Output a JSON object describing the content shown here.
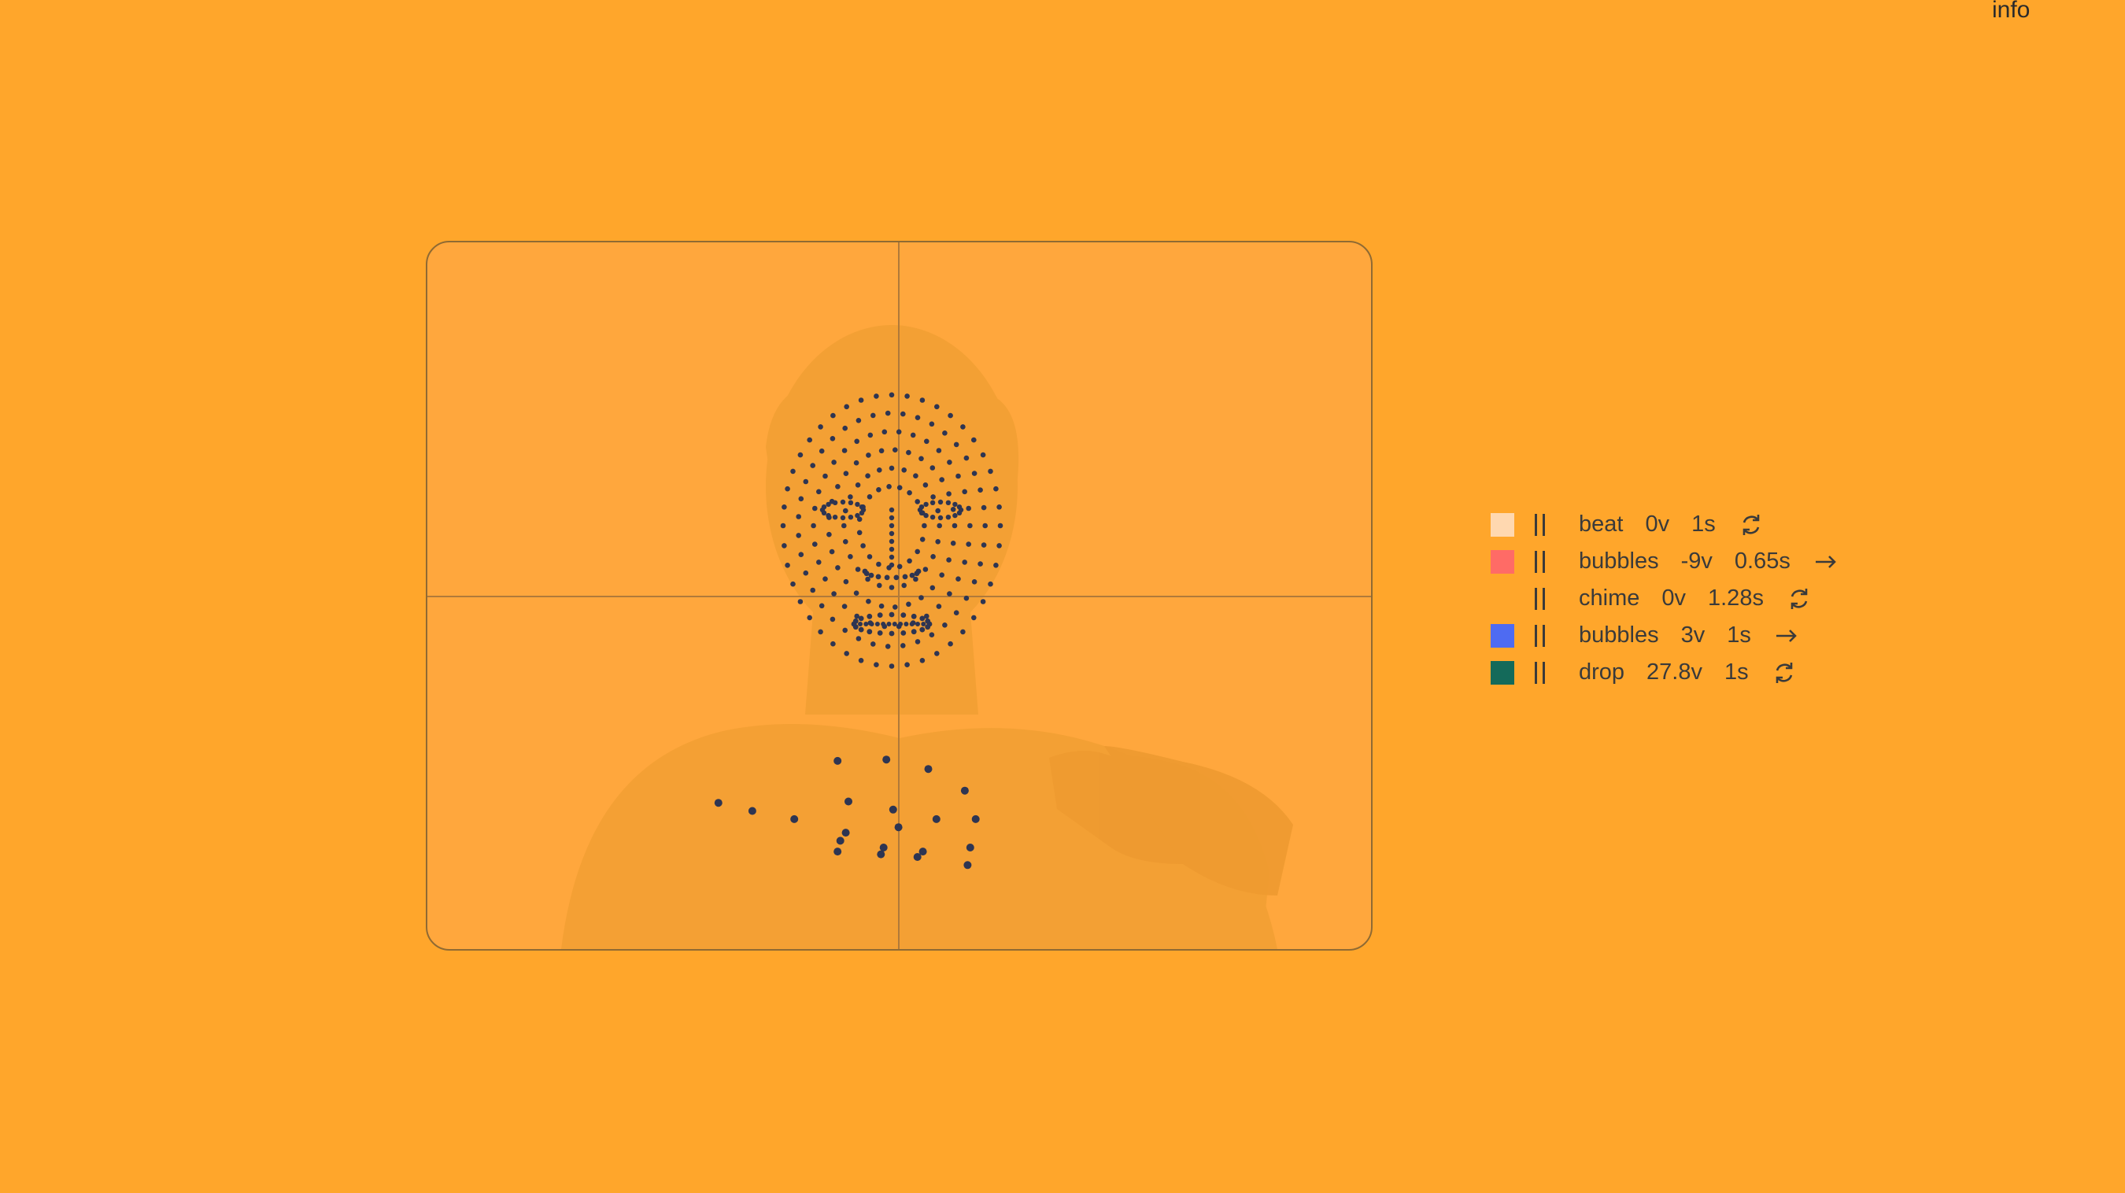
{
  "header": {
    "info_label": "info"
  },
  "colors": {
    "background": "#FFA62B",
    "overlay_dot": "#2e3552"
  },
  "sounds": [
    {
      "swatch_color": "#FFD8B0",
      "name": "beat",
      "volume": "0v",
      "duration": "1s",
      "mode_icon": "loop-icon"
    },
    {
      "swatch_color": "#FF6B66",
      "name": "bubbles",
      "volume": "-9v",
      "duration": "0.65s",
      "mode_icon": "arrow-right-icon"
    },
    {
      "swatch_color": "#FFA62B",
      "name": "chime",
      "volume": "0v",
      "duration": "1.28s",
      "mode_icon": "loop-icon"
    },
    {
      "swatch_color": "#4E6BF2",
      "name": "bubbles",
      "volume": "3v",
      "duration": "1s",
      "mode_icon": "arrow-right-icon"
    },
    {
      "swatch_color": "#146A5A",
      "name": "drop",
      "volume": "27.8v",
      "duration": "1s",
      "mode_icon": "loop-icon"
    }
  ]
}
